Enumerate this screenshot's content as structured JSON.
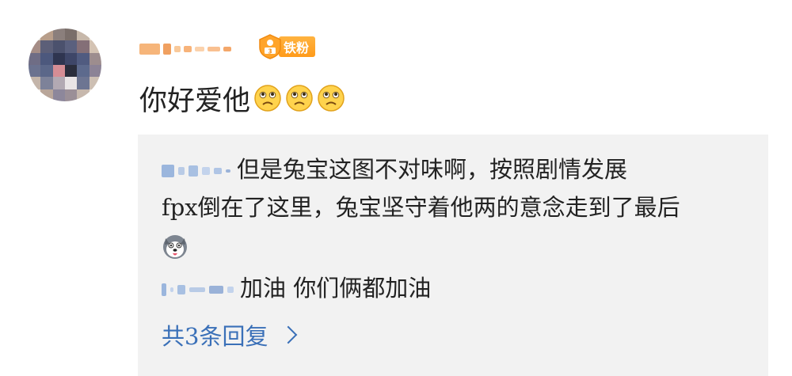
{
  "post": {
    "fan_badge_label": "铁粉",
    "comment_text": "你好爱他",
    "emoji_names": [
      "sad-face-icon",
      "sad-face-icon",
      "sad-face-icon"
    ]
  },
  "replies": {
    "reply1_line1": "但是兔宝这图不对味啊，按照剧情发展",
    "reply1_line2": "fpx倒在了这里，兔宝坚守着他两的意念走到了最后",
    "reply2_text": "加油 你们俩都加油",
    "more_label": "共3条回复"
  },
  "colors": {
    "link": "#3a70b8",
    "badge": "#ff9b1a",
    "reply_bg": "#f2f2f2"
  }
}
